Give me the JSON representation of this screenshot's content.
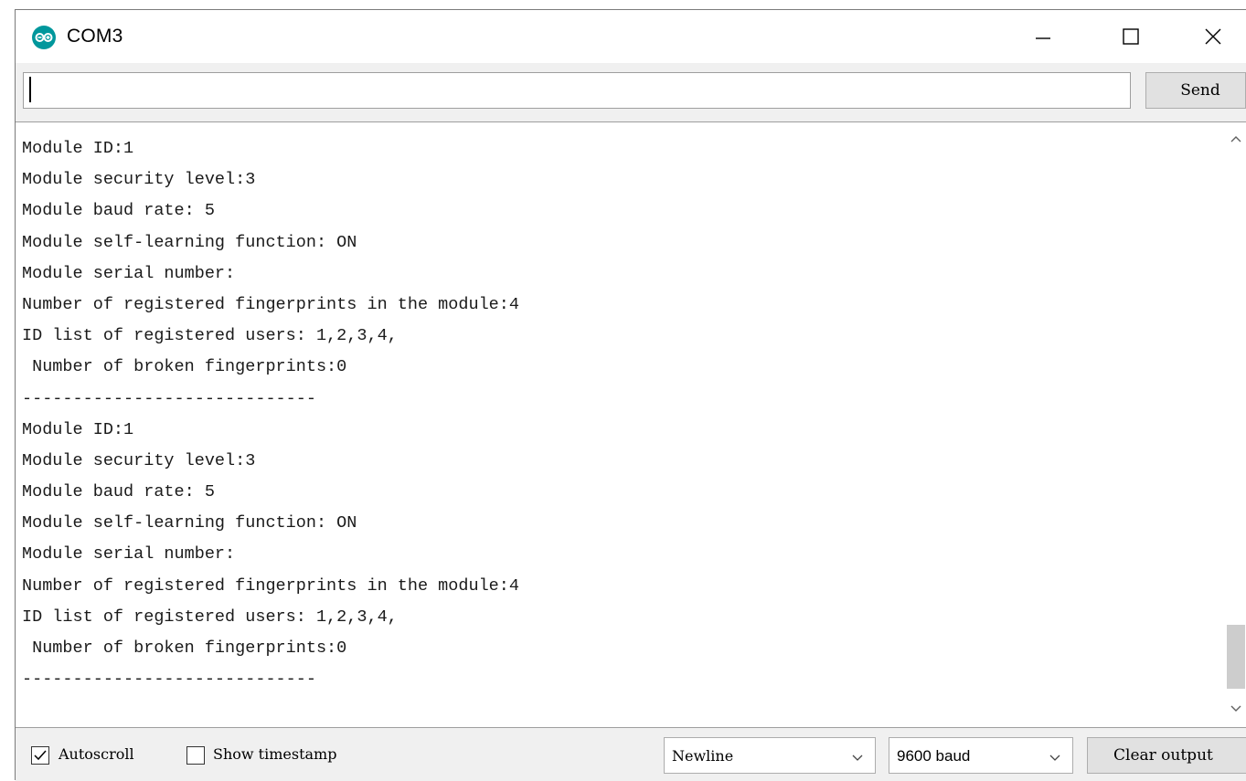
{
  "window": {
    "title": "COM3",
    "icon": "arduino-icon"
  },
  "titlebar_buttons": [
    "minimize-icon",
    "maximize-icon",
    "close-icon"
  ],
  "send": {
    "input_value": "",
    "button_label": "Send"
  },
  "output": {
    "lines": [
      "Module ID:1",
      "Module security level:3",
      "Module baud rate: 5",
      "Module self-learning function: ON",
      "Module serial number:",
      "Number of registered fingerprints in the module:4",
      "ID list of registered users: 1,2,3,4,",
      " Number of broken fingerprints:0",
      "-----------------------------",
      "Module ID:1",
      "Module security level:3",
      "Module baud rate: 5",
      "Module self-learning function: ON",
      "Module serial number:",
      "Number of registered fingerprints in the module:4",
      "ID list of registered users: 1,2,3,4,",
      " Number of broken fingerprints:0",
      "-----------------------------"
    ]
  },
  "footer": {
    "autoscroll_label": "Autoscroll",
    "autoscroll_checked": true,
    "timestamp_label": "Show timestamp",
    "timestamp_checked": false,
    "line_ending_value": "Newline",
    "baud_value": "9600 baud",
    "clear_label": "Clear output"
  },
  "colors": {
    "arduino_teal": "#00979c",
    "chrome_bg": "#f0f0f0",
    "button_bg": "#e1e1e1"
  }
}
